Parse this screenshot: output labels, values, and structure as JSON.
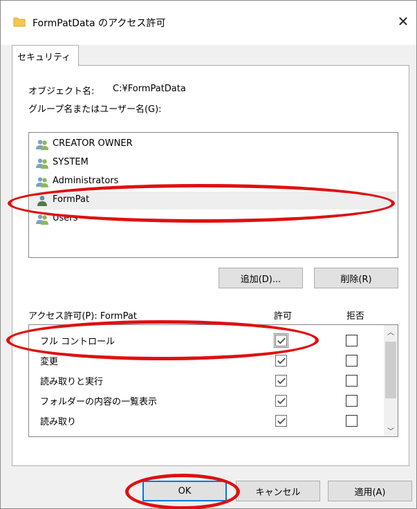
{
  "window": {
    "title": "FormPatData のアクセス許可",
    "close_glyph": "✕"
  },
  "tab": {
    "label": "セキュリティ"
  },
  "object": {
    "label": "オブジェクト名:",
    "value": "C:¥FormPatData"
  },
  "group_label": "グループ名またはユーザー名(G):",
  "users": [
    {
      "name": "CREATOR OWNER",
      "icon": "user-group-icon"
    },
    {
      "name": "SYSTEM",
      "icon": "user-group-icon"
    },
    {
      "name": "Administrators",
      "icon": "user-group-icon"
    },
    {
      "name": "FormPat",
      "icon": "user-icon",
      "selected": true
    },
    {
      "name": "Users",
      "icon": "user-group-icon"
    }
  ],
  "buttons": {
    "add": "追加(D)...",
    "remove": "削除(R)",
    "ok": "OK",
    "cancel": "キャンセル",
    "apply": "適用(A)"
  },
  "permissions": {
    "header": "アクセス許可(P): FormPat",
    "allow_col": "許可",
    "deny_col": "拒否",
    "rows": [
      {
        "name": "フル コントロール",
        "allow": true,
        "deny": false
      },
      {
        "name": "変更",
        "allow": true,
        "deny": false
      },
      {
        "name": "読み取りと実行",
        "allow": true,
        "deny": false
      },
      {
        "name": "フォルダーの内容の一覧表示",
        "allow": true,
        "deny": false
      },
      {
        "name": "読み取り",
        "allow": true,
        "deny": false
      }
    ]
  },
  "scroll": {
    "up_glyph": "︿",
    "down_glyph": "﹀"
  },
  "colors": {
    "annotation": "#e01010",
    "accent": "#0078d7",
    "folder": "#f2c94c"
  }
}
